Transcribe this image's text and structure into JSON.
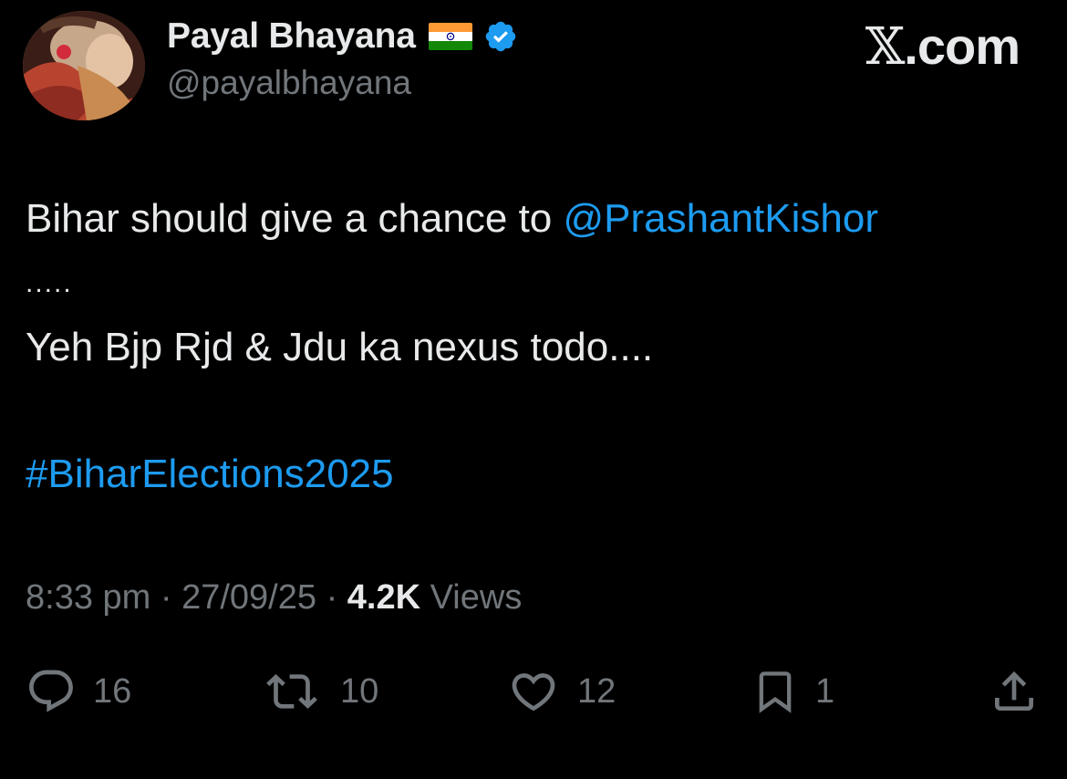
{
  "profile": {
    "display_name": "Payal Bhayana",
    "handle": "@payalbhayana",
    "flag_icon": "india-flag-emoji",
    "verified_icon": "verified-badge-icon",
    "verified_color": "#1d9bf0"
  },
  "brand": {
    "x_glyph": "𝕏",
    "domain": ".com"
  },
  "tweet": {
    "line1_text": "Bihar should give a chance to ",
    "line1_mention": "@PrashantKishor",
    "line2": ".....",
    "line3": "Yeh Bjp Rjd & Jdu ka nexus todo....",
    "hashtag": "#BiharElections2025"
  },
  "meta": {
    "time": "8:33 pm",
    "separator1": " · ",
    "date": "27/09/25",
    "separator2": " · ",
    "views_count": "4.2K",
    "views_label": " Views"
  },
  "actions": {
    "reply": {
      "icon": "reply-icon",
      "count": "16"
    },
    "repost": {
      "icon": "repost-icon",
      "count": "10"
    },
    "like": {
      "icon": "heart-icon",
      "count": "12"
    },
    "bookmark": {
      "icon": "bookmark-icon",
      "count": "1"
    },
    "share": {
      "icon": "share-icon"
    }
  },
  "colors": {
    "background": "#000000",
    "text": "#e7e9ea",
    "secondary": "#71767b",
    "accent": "#1d9bf0"
  }
}
